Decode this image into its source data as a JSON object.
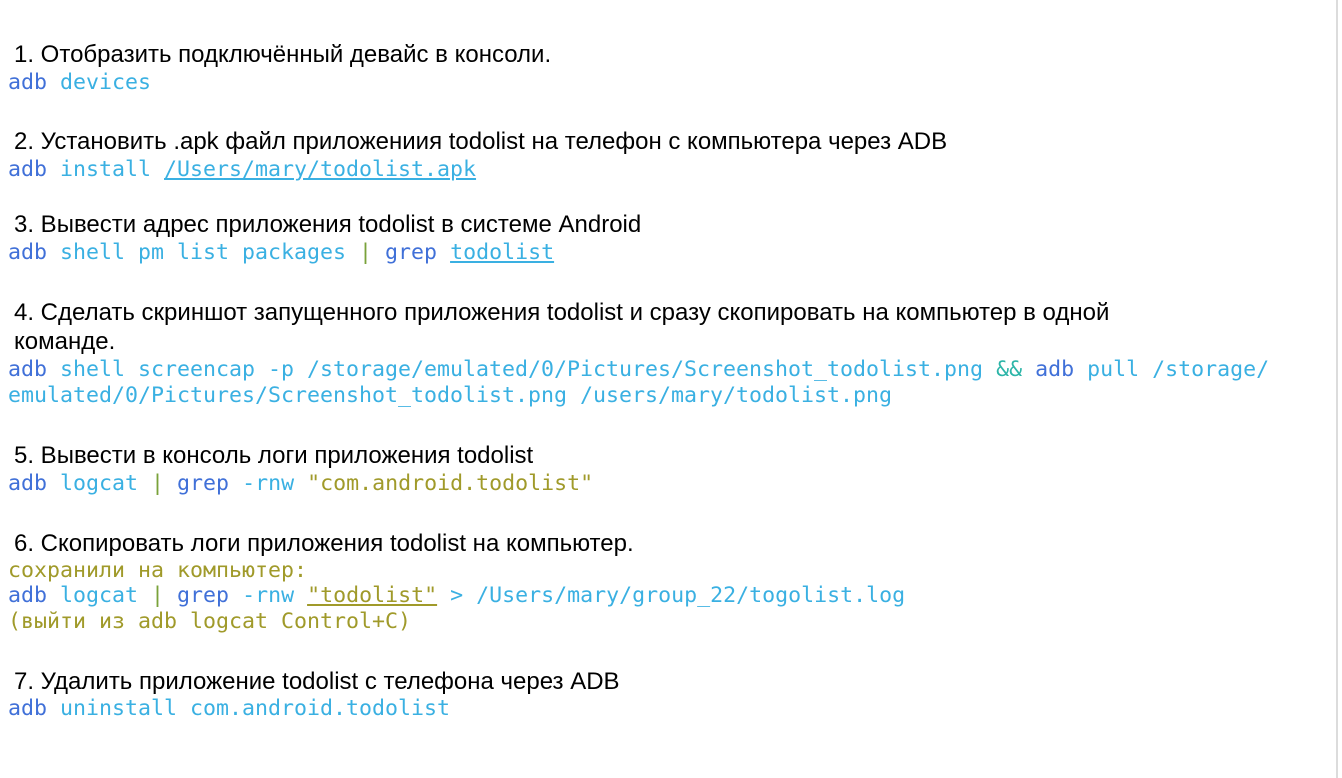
{
  "colors": {
    "keyword": "#4070d8",
    "command": "#3ab0e2",
    "pipe": "#7aa23a",
    "operator": "#2cb5a8",
    "string": "#a09a2a",
    "heading": "#000000"
  },
  "steps": [
    {
      "heading": "1. Отобразить подключённый девайс в консоли.",
      "cmd": {
        "adb": "adb",
        "rest": " devices"
      }
    },
    {
      "heading": "2. Установить .apk файл приложениия todolist на телефон с компьютера через  ADB",
      "cmd": {
        "adb": "adb",
        "sub": " install ",
        "path": "/Users/mary/todolist.apk"
      }
    },
    {
      "heading": "3. Вывести адрес приложения todolist в системе Android",
      "cmd": {
        "adb": "adb",
        "sub": " shell pm list packages ",
        "pipe": "|",
        "grep": " grep ",
        "arg": "todolist"
      }
    },
    {
      "heading_line1": "4. Сделать скриншот запущенного приложения todolist и сразу скопировать на компьютер в одной",
      "heading_line2": "команде.",
      "cmd": {
        "adb1": "adb",
        "part1": " shell screencap -p /storage/emulated/0/Pictures/Screenshot_todolist.png ",
        "and": "&&",
        "adb2": " adb",
        "part2": " pull /storage/",
        "line2": "emulated/0/Pictures/Screenshot_todolist.png /users/mary/todolist.png"
      }
    },
    {
      "heading": "5. Вывести в консоль логи приложения todolist",
      "cmd": {
        "adb": "adb",
        "sub": " logcat ",
        "pipe": "|",
        "grep": " grep ",
        "flag": "-rnw ",
        "str": "\"com.android.todolist\""
      }
    },
    {
      "heading": "6. Скопировать логи приложения todolist на компьютер.",
      "note1": "сохранили на компьютер:",
      "cmd": {
        "adb": "adb",
        "sub": " logcat ",
        "pipe": "|",
        "grep": " grep ",
        "flag": "-rnw ",
        "str": "\"todolist\"",
        "rest": " > /Users/mary/group_22/togolist.log"
      },
      "note2": "(выйти из adb logcat Control+C)"
    },
    {
      "heading": "7. Удалить приложение todolist с телефона через ADB",
      "cmd": {
        "adb": "adb",
        "rest": " uninstall com.android.todolist"
      }
    }
  ]
}
